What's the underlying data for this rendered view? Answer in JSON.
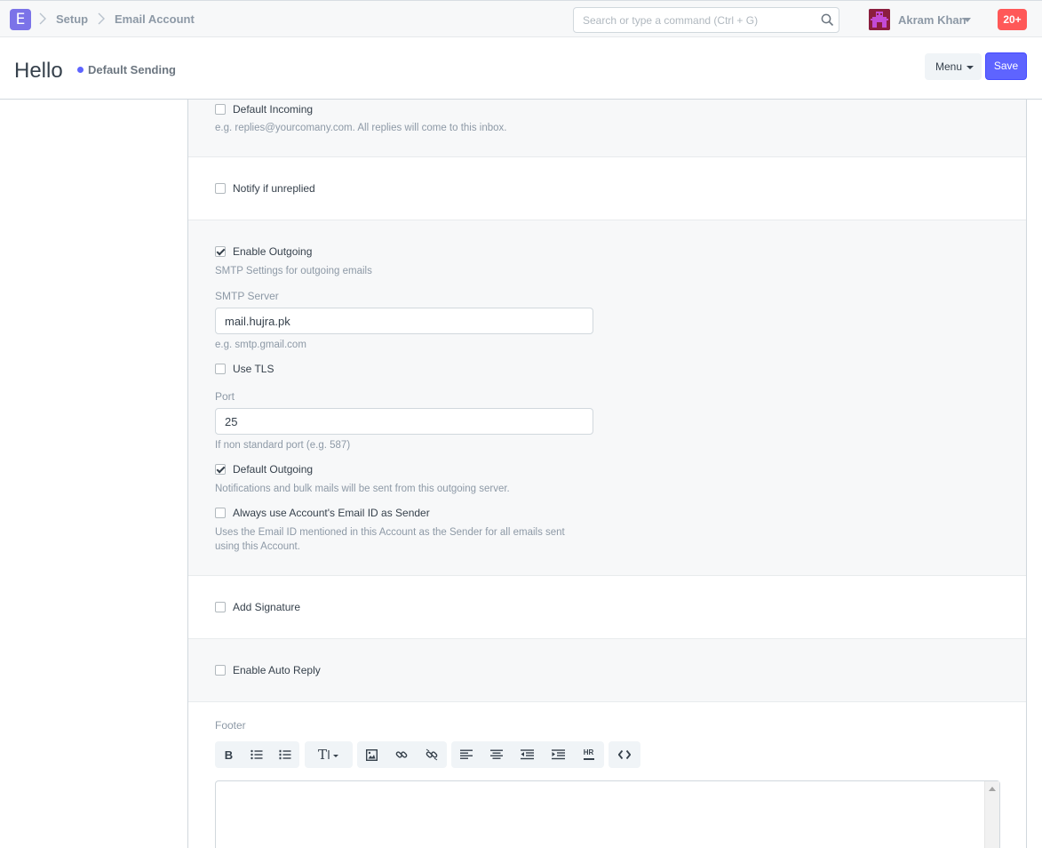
{
  "navbar": {
    "logo_letter": "E",
    "breadcrumbs": [
      "Setup",
      "Email Account"
    ],
    "search_placeholder": "Search or type a command (Ctrl + G)",
    "user_name": "Akram Khan",
    "notification_count": "20+"
  },
  "page_head": {
    "title": "Hello",
    "status": "Default Sending",
    "status_color": "#5e64ff",
    "menu_label": "Menu",
    "save_label": "Save"
  },
  "form": {
    "default_incoming": {
      "label": "Default Incoming",
      "checked": false,
      "help": "e.g. replies@yourcomany.com. All replies will come to this inbox."
    },
    "notify_unreplied": {
      "label": "Notify if unreplied",
      "checked": false
    },
    "enable_outgoing": {
      "label": "Enable Outgoing",
      "checked": true,
      "help": "SMTP Settings for outgoing emails"
    },
    "smtp_server": {
      "label": "SMTP Server",
      "value": "mail.hujra.pk",
      "help": "e.g. smtp.gmail.com"
    },
    "use_tls": {
      "label": "Use TLS",
      "checked": false
    },
    "port": {
      "label": "Port",
      "value": "25",
      "help": "If non standard port (e.g. 587)"
    },
    "default_outgoing": {
      "label": "Default Outgoing",
      "checked": true,
      "help": "Notifications and bulk mails will be sent from this outgoing server."
    },
    "always_use_sender": {
      "label": "Always use Account's Email ID as Sender",
      "checked": false,
      "help_line1": "Uses the Email ID mentioned in this Account as the Sender for all emails sent",
      "help_line2": "using this Account."
    },
    "add_signature": {
      "label": "Add Signature",
      "checked": false
    },
    "enable_auto_reply": {
      "label": "Enable Auto Reply",
      "checked": false
    },
    "footer": {
      "label": "Footer",
      "toolbar_text": {
        "bold": "B",
        "font_size": "T",
        "hr": "HR"
      },
      "toolbar_icons": [
        "bold-icon",
        "bullet-list-icon",
        "numbered-list-icon",
        "font-size-icon",
        "image-icon",
        "link-icon",
        "unlink-icon",
        "align-left-icon",
        "align-center-icon",
        "outdent-icon",
        "indent-icon",
        "horizontal-rule-icon",
        "code-view-icon"
      ]
    }
  },
  "colors": {
    "primary": "#5e64ff",
    "badge": "#ff5858",
    "logo": "#7b73e8",
    "avatar": "#8b1e3f"
  }
}
